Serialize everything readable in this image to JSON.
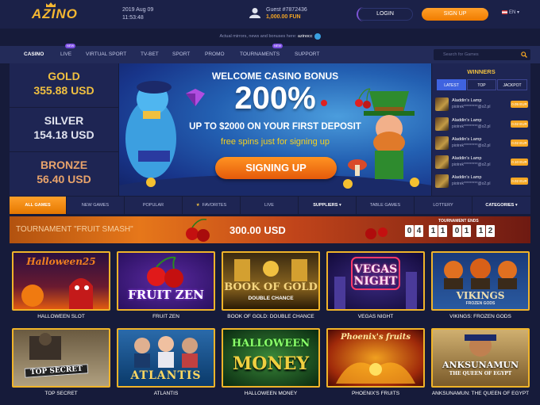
{
  "header": {
    "logo": "AZINO",
    "date": "2019 Aug 09",
    "time": "11:53:48",
    "guest": "Guest #7872436",
    "balance": "1,000.00 FUN",
    "login": "LOGIN",
    "signup": "SIGN UP",
    "lang": "EN"
  },
  "mirror": {
    "text": "Actual mirrors, news and bonuses here:",
    "link": "azinocc"
  },
  "nav": {
    "items": [
      "CASINO",
      "LIVE",
      "VIRTUAL SPORT",
      "TV-BET",
      "SPORT",
      "PROMO",
      "TOURNAMENTS",
      "SUPPORT"
    ],
    "new_badge": "NEW",
    "search_placeholder": "Search for Games"
  },
  "jackpots": [
    {
      "title": "GOLD",
      "value": "355.88 USD"
    },
    {
      "title": "SILVER",
      "value": "154.18 USD"
    },
    {
      "title": "BRONZE",
      "value": "56.40 USD"
    }
  ],
  "banner": {
    "line1": "WELCOME CASINO BONUS",
    "line2": "200%",
    "line3": "UP TO $2000 ON YOUR FIRST DEPOSIT",
    "line4": "free spins just for signing up",
    "button": "SIGNING UP"
  },
  "winners": {
    "title": "WINNERS",
    "tabs": [
      "LATEST",
      "TOP",
      "JACKPOT"
    ],
    "rows": [
      {
        "game": "Aladdin's Lamp",
        "user": "piotrek*********@o2.pl",
        "amount": "0.05 EUR"
      },
      {
        "game": "Aladdin's Lamp",
        "user": "piotrek*********@o2.pl",
        "amount": "0.02 EUR"
      },
      {
        "game": "Aladdin's Lamp",
        "user": "piotrek*********@o2.pl",
        "amount": "0.02 EUR"
      },
      {
        "game": "Aladdin's Lamp",
        "user": "piotrek*********@o2.pl",
        "amount": "0.10 EUR"
      },
      {
        "game": "Aladdin's Lamp",
        "user": "piotrek*********@o2.pl",
        "amount": "0.02 EUR"
      }
    ]
  },
  "game_tabs": [
    "ALL GAMES",
    "NEW GAMES",
    "POPULAR",
    "FAVORITES",
    "LIVE",
    "SUPPLIERS",
    "TABLE GAMES",
    "LOTTERY",
    "CATEGORIES"
  ],
  "tournament": {
    "title": "TOURNAMENT \"FRUIT SMASH\"",
    "prize": "300.00 USD",
    "ends_label": "TOURNAMENT ENDS",
    "timer": [
      "0",
      "4",
      "1",
      "1",
      "0",
      "1",
      "1",
      "2"
    ]
  },
  "games": [
    {
      "name": "HALLOWEEN SLOT",
      "art": "Halloween25"
    },
    {
      "name": "FRUIT ZEN",
      "art": "FRUIT ZEN"
    },
    {
      "name": "BOOK OF GOLD: DOUBLE CHANCE",
      "art": "BOOK OF GOLD",
      "sub": "DOUBLE CHANCE"
    },
    {
      "name": "VEGAS NIGHT",
      "art": "VEGAS NIGHT"
    },
    {
      "name": "VIKINGS: FROZEN GODS",
      "art": "VIKINGS",
      "sub": "FROZEN GODS"
    },
    {
      "name": "TOP SECRET",
      "art": "TOP SECRET"
    },
    {
      "name": "ATLANTIS",
      "art": "ATLANTIS"
    },
    {
      "name": "HALLOWEEN MONEY",
      "art": "HALLOWEEN",
      "sub": "MONEY"
    },
    {
      "name": "PHOENIX'S FRUITS",
      "art": "Phoenix's fruits"
    },
    {
      "name": "ANKSUNAMUN: THE QUEEN OF EGYPT",
      "art": "ANKSUNAMUN",
      "sub": "THE QUEEN OF EGYPT"
    }
  ]
}
